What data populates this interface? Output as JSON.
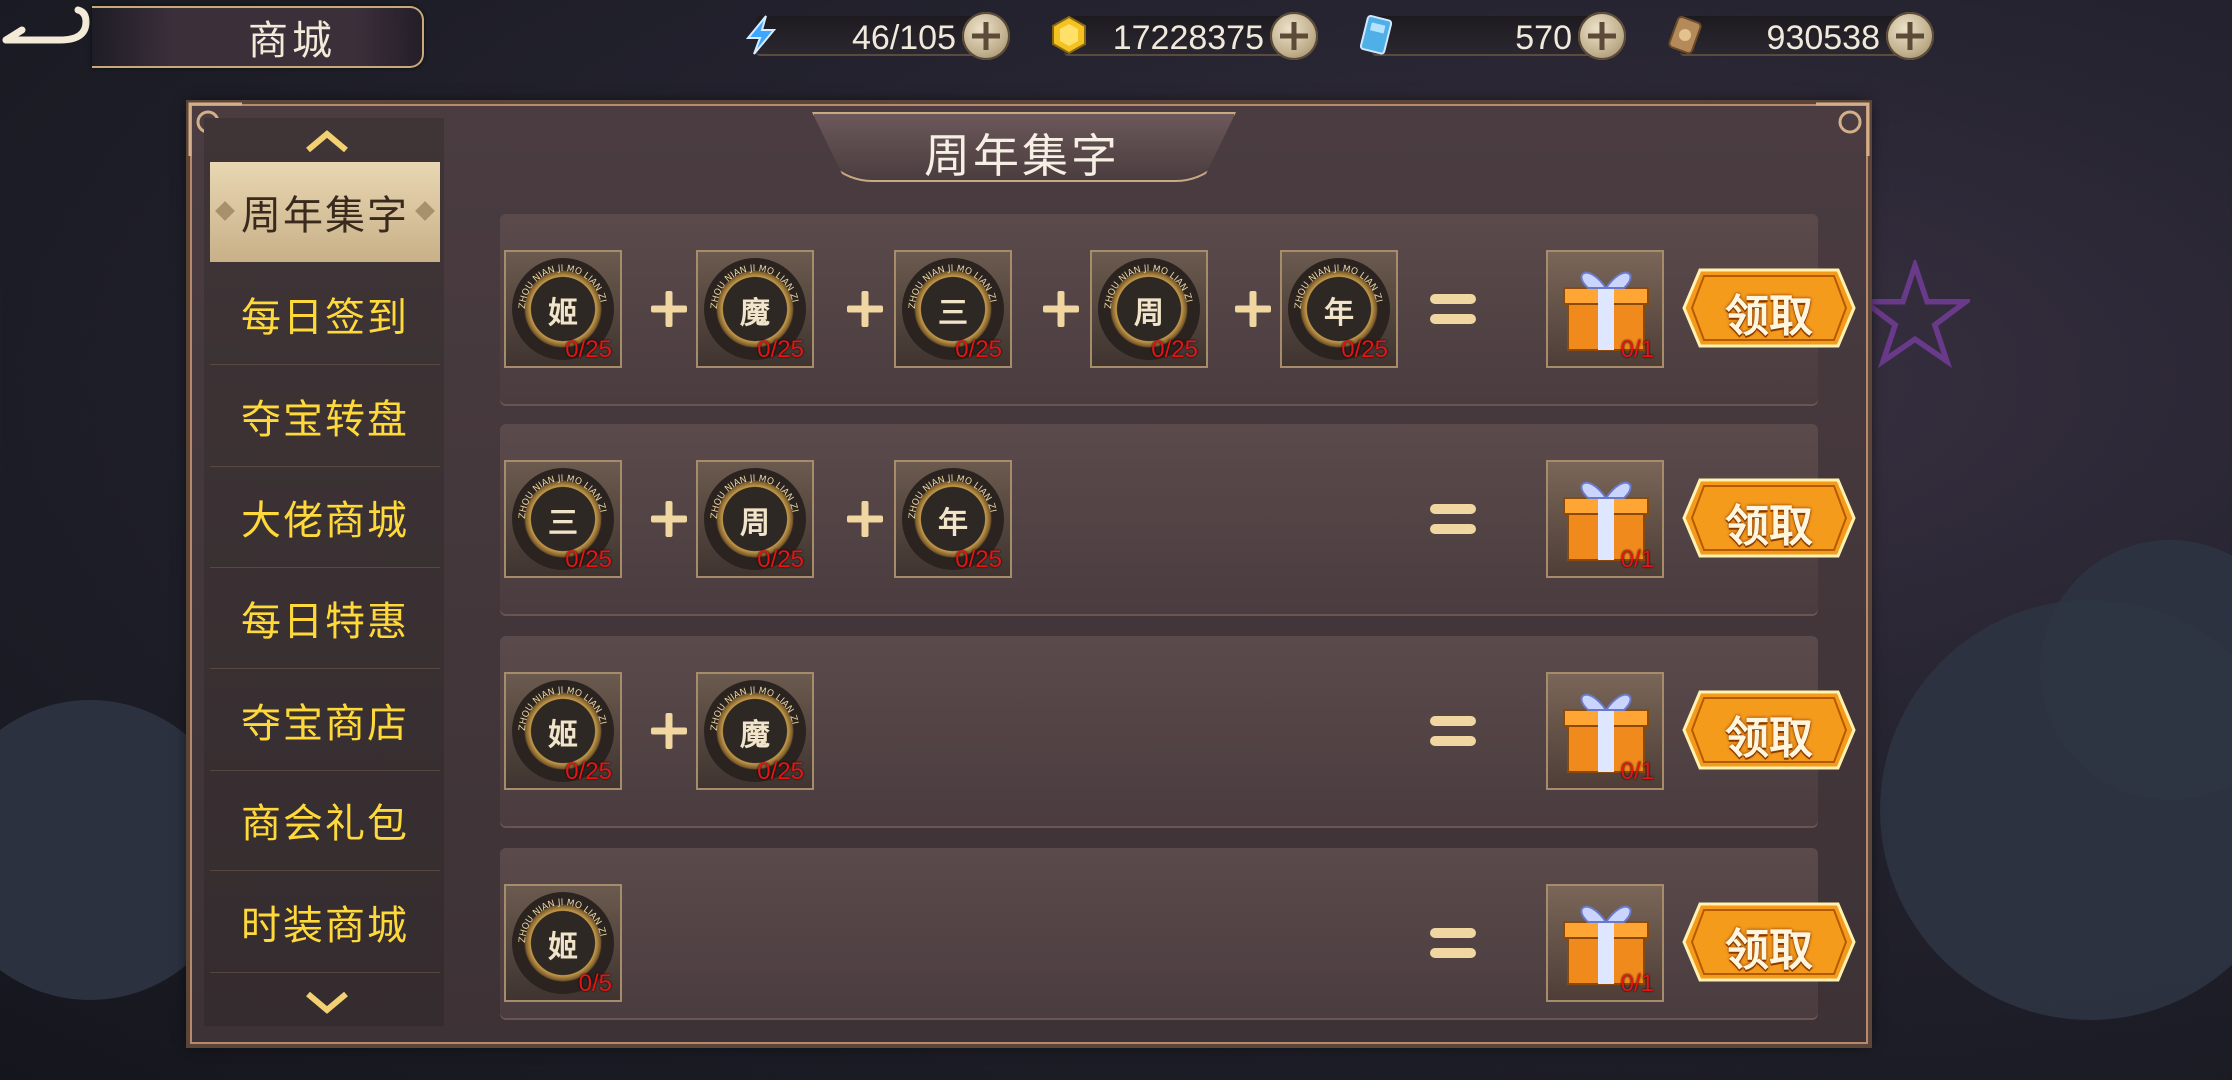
{
  "header": {
    "title": "商城"
  },
  "resources": [
    {
      "icon": "energy-bolt-icon",
      "value": "46/105"
    },
    {
      "icon": "gold-coin-icon",
      "value": "17228375"
    },
    {
      "icon": "blue-ticket-icon",
      "value": "570"
    },
    {
      "icon": "bronze-token-icon",
      "value": "930538"
    }
  ],
  "sidebar": {
    "items": [
      {
        "label": "周年集字",
        "active": true
      },
      {
        "label": "每日签到"
      },
      {
        "label": "夺宝转盘"
      },
      {
        "label": "大佬商城"
      },
      {
        "label": "每日特惠"
      },
      {
        "label": "夺宝商店"
      },
      {
        "label": "商会礼包"
      },
      {
        "label": "时装商城"
      }
    ]
  },
  "panel": {
    "title": "周年集字"
  },
  "coin_ring_text": "ZHOU NIAN JI MO LIAN ZI",
  "recipes": [
    {
      "coins": [
        {
          "char": "姬",
          "count": "0/25"
        },
        {
          "char": "魔",
          "count": "0/25"
        },
        {
          "char": "三",
          "count": "0/25"
        },
        {
          "char": "周",
          "count": "0/25"
        },
        {
          "char": "年",
          "count": "0/25"
        }
      ],
      "reward_count": "0/1",
      "button": "领取"
    },
    {
      "coins": [
        {
          "char": "三",
          "count": "0/25"
        },
        {
          "char": "周",
          "count": "0/25"
        },
        {
          "char": "年",
          "count": "0/25"
        }
      ],
      "reward_count": "0/1",
      "button": "领取"
    },
    {
      "coins": [
        {
          "char": "姬",
          "count": "0/25"
        },
        {
          "char": "魔",
          "count": "0/25"
        }
      ],
      "reward_count": "0/1",
      "button": "领取"
    },
    {
      "coins": [
        {
          "char": "姬",
          "count": "0/5"
        }
      ],
      "reward_count": "0/1",
      "button": "领取"
    }
  ],
  "colors": {
    "nav_text": "#ffd93a",
    "count_text": "#e81414",
    "button_orange": "#f59b1c"
  }
}
